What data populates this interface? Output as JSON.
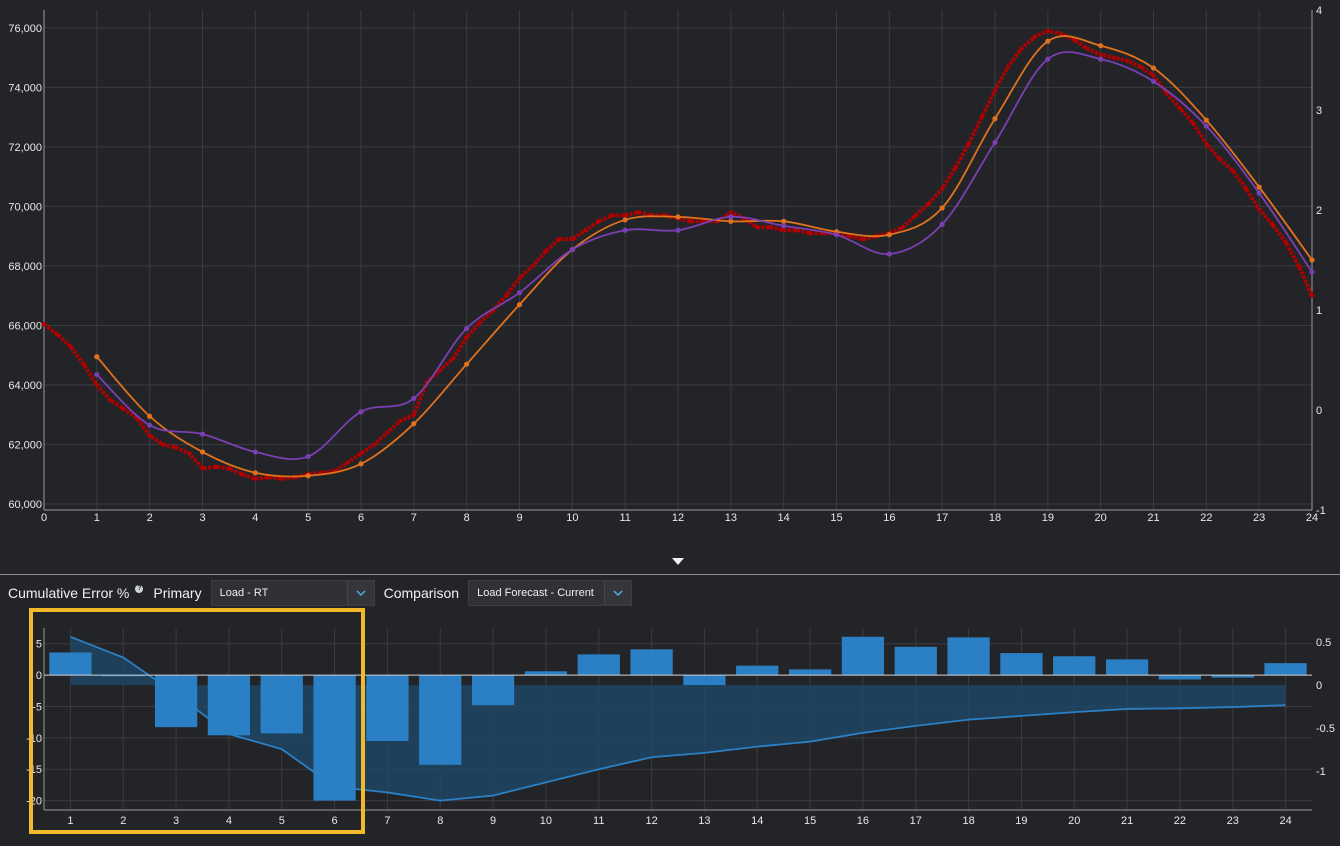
{
  "colors": {
    "actual": "#b00000",
    "forecast": "#e0721e",
    "comparison": "#7a3fb2",
    "bar": "#2b80c5",
    "cumulative_line": "#2b80c5",
    "cumulative_area": "#1d4a6b",
    "highlight": "#f2b92b"
  },
  "controls": {
    "cumulative_label": "Cumulative Error %",
    "help_icon": "?",
    "primary_label": "Primary",
    "primary_value": "Load - RT",
    "comparison_label": "Comparison",
    "comparison_value": "Load Forecast - Current"
  },
  "chart_data": [
    {
      "type": "line",
      "x_axis": {
        "min": 0,
        "max": 24,
        "ticks": [
          0,
          1,
          2,
          3,
          4,
          5,
          6,
          7,
          8,
          9,
          10,
          11,
          12,
          13,
          14,
          15,
          16,
          17,
          18,
          19,
          20,
          21,
          22,
          23,
          24
        ]
      },
      "y_axis_left": {
        "min": 59800,
        "max": 76600,
        "ticks": [
          60000,
          62000,
          64000,
          66000,
          68000,
          70000,
          72000,
          74000,
          76000
        ],
        "tick_labels": [
          "60,000",
          "62,000",
          "64,000",
          "66,000",
          "68,000",
          "70,000",
          "72,000",
          "74,000",
          "76,000"
        ]
      },
      "y_axis_right": {
        "min": -1,
        "max": 4,
        "ticks": [
          -1,
          0,
          1,
          2,
          3,
          4
        ],
        "tick_labels": [
          "-1",
          "0",
          "1",
          "2",
          "3",
          "4"
        ]
      },
      "grid": true,
      "series": [
        {
          "key": "actual",
          "style": "dense-dots",
          "points": [
            [
              0,
              66050
            ],
            [
              0.25,
              65700
            ],
            [
              0.5,
              65300
            ],
            [
              0.75,
              64700
            ],
            [
              1,
              64000
            ],
            [
              1.25,
              63500
            ],
            [
              1.5,
              63200
            ],
            [
              1.75,
              62900
            ],
            [
              2,
              62300
            ],
            [
              2.25,
              62000
            ],
            [
              2.5,
              61900
            ],
            [
              2.75,
              61700
            ],
            [
              3,
              61200
            ],
            [
              3.25,
              61250
            ],
            [
              3.5,
              61200
            ],
            [
              3.75,
              61000
            ],
            [
              4,
              60850
            ],
            [
              4.25,
              60900
            ],
            [
              4.5,
              60850
            ],
            [
              4.75,
              60900
            ],
            [
              5,
              61000
            ],
            [
              5.25,
              61050
            ],
            [
              5.5,
              61100
            ],
            [
              5.75,
              61400
            ],
            [
              6,
              61700
            ],
            [
              6.25,
              62000
            ],
            [
              6.5,
              62400
            ],
            [
              6.75,
              62800
            ],
            [
              7,
              63000
            ],
            [
              7.25,
              64100
            ],
            [
              7.5,
              64500
            ],
            [
              7.75,
              64900
            ],
            [
              8,
              65600
            ],
            [
              8.25,
              66100
            ],
            [
              8.5,
              66500
            ],
            [
              8.75,
              67000
            ],
            [
              9,
              67600
            ],
            [
              9.25,
              68000
            ],
            [
              9.5,
              68500
            ],
            [
              9.75,
              68900
            ],
            [
              10,
              68900
            ],
            [
              10.25,
              69200
            ],
            [
              10.5,
              69500
            ],
            [
              10.75,
              69700
            ],
            [
              11,
              69700
            ],
            [
              11.25,
              69800
            ],
            [
              11.5,
              69700
            ],
            [
              11.75,
              69700
            ],
            [
              12,
              69600
            ],
            [
              12.25,
              69500
            ],
            [
              12.5,
              69500
            ],
            [
              12.75,
              69500
            ],
            [
              13,
              69800
            ],
            [
              13.25,
              69600
            ],
            [
              13.5,
              69300
            ],
            [
              13.75,
              69300
            ],
            [
              14,
              69200
            ],
            [
              14.25,
              69200
            ],
            [
              14.5,
              69100
            ],
            [
              14.75,
              69100
            ],
            [
              15,
              69100
            ],
            [
              15.25,
              69000
            ],
            [
              15.5,
              68900
            ],
            [
              15.75,
              69000
            ],
            [
              16,
              69100
            ],
            [
              16.25,
              69300
            ],
            [
              16.5,
              69700
            ],
            [
              16.75,
              70100
            ],
            [
              17,
              70600
            ],
            [
              17.25,
              71300
            ],
            [
              17.5,
              72100
            ],
            [
              17.75,
              73000
            ],
            [
              18,
              73900
            ],
            [
              18.25,
              74700
            ],
            [
              18.5,
              75300
            ],
            [
              18.75,
              75700
            ],
            [
              19,
              75900
            ],
            [
              19.25,
              75800
            ],
            [
              19.5,
              75600
            ],
            [
              19.75,
              75300
            ],
            [
              20,
              75100
            ],
            [
              20.25,
              75000
            ],
            [
              20.5,
              74900
            ],
            [
              20.75,
              74700
            ],
            [
              21,
              74400
            ],
            [
              21.25,
              73800
            ],
            [
              21.5,
              73300
            ],
            [
              21.75,
              72800
            ],
            [
              22,
              72100
            ],
            [
              22.25,
              71600
            ],
            [
              22.5,
              71200
            ],
            [
              22.75,
              70600
            ],
            [
              23,
              69900
            ],
            [
              23.25,
              69400
            ],
            [
              23.5,
              68800
            ],
            [
              23.75,
              68000
            ],
            [
              24,
              67000
            ]
          ]
        },
        {
          "key": "forecast",
          "style": "line-markers",
          "points": [
            [
              1,
              64950
            ],
            [
              2,
              62950
            ],
            [
              3,
              61750
            ],
            [
              4,
              61050
            ],
            [
              5,
              60950
            ],
            [
              6,
              61350
            ],
            [
              7,
              62700
            ],
            [
              8,
              64700
            ],
            [
              9,
              66700
            ],
            [
              10,
              68550
            ],
            [
              11,
              69550
            ],
            [
              12,
              69650
            ],
            [
              13,
              69500
            ],
            [
              14,
              69500
            ],
            [
              15,
              69150
            ],
            [
              16,
              69050
            ],
            [
              17,
              69950
            ],
            [
              18,
              72950
            ],
            [
              19,
              75550
            ],
            [
              20,
              75400
            ],
            [
              21,
              74650
            ],
            [
              22,
              72900
            ],
            [
              23,
              70650
            ],
            [
              24,
              68200
            ]
          ]
        },
        {
          "key": "comparison",
          "style": "line-markers",
          "points": [
            [
              1,
              64350
            ],
            [
              2,
              62650
            ],
            [
              3,
              62350
            ],
            [
              4,
              61750
            ],
            [
              5,
              61600
            ],
            [
              6,
              63100
            ],
            [
              7,
              63550
            ],
            [
              8,
              65900
            ],
            [
              9,
              67100
            ],
            [
              10,
              68550
            ],
            [
              11,
              69200
            ],
            [
              12,
              69200
            ],
            [
              13,
              69650
            ],
            [
              14,
              69350
            ],
            [
              15,
              69050
            ],
            [
              16,
              68400
            ],
            [
              17,
              69400
            ],
            [
              18,
              72150
            ],
            [
              19,
              74950
            ],
            [
              20,
              74950
            ],
            [
              21,
              74200
            ],
            [
              22,
              72700
            ],
            [
              23,
              70450
            ],
            [
              24,
              67800
            ]
          ]
        }
      ]
    },
    {
      "type": "bar",
      "x_axis": {
        "min": 0.5,
        "max": 24.5,
        "ticks": [
          1,
          2,
          3,
          4,
          5,
          6,
          7,
          8,
          9,
          10,
          11,
          12,
          13,
          14,
          15,
          16,
          17,
          18,
          19,
          20,
          21,
          22,
          23,
          24
        ]
      },
      "y_axis_left": {
        "min": -21.5,
        "max": 7.5,
        "ticks": [
          -20,
          -15,
          -10,
          -5,
          0,
          5
        ],
        "tick_labels": [
          "-20",
          "-15",
          "-10",
          "-5",
          "0",
          "5"
        ]
      },
      "y_axis_right": {
        "min": -1.45,
        "max": 0.66,
        "ticks": [
          -1,
          -0.5,
          0,
          0.5
        ],
        "tick_labels": [
          "-1",
          "-0.5",
          "0",
          "0.5"
        ]
      },
      "grid": true,
      "categories": [
        1,
        2,
        3,
        4,
        5,
        6,
        7,
        8,
        9,
        10,
        11,
        12,
        13,
        14,
        15,
        16,
        17,
        18,
        19,
        20,
        21,
        22,
        23,
        24
      ],
      "bars": [
        3.6,
        -0.2,
        -8.3,
        -9.6,
        -9.3,
        -20.0,
        -10.5,
        -14.3,
        -4.8,
        0.6,
        3.3,
        4.1,
        -1.6,
        1.5,
        0.9,
        6.1,
        4.5,
        6.0,
        3.5,
        3.0,
        2.5,
        -0.7,
        -0.4,
        1.9
      ],
      "cumulative": [
        6.1,
        2.8,
        -3.0,
        -9.4,
        -11.8,
        -17.8,
        -18.7,
        -20.0,
        -19.2,
        -17.1,
        -15.0,
        -13.1,
        -12.4,
        -11.4,
        -10.6,
        -9.2,
        -8.1,
        -7.1,
        -6.5,
        -5.9,
        -5.4,
        -5.3,
        -5.1,
        -4.8
      ],
      "cumulative_baseline": -1.6
    }
  ]
}
